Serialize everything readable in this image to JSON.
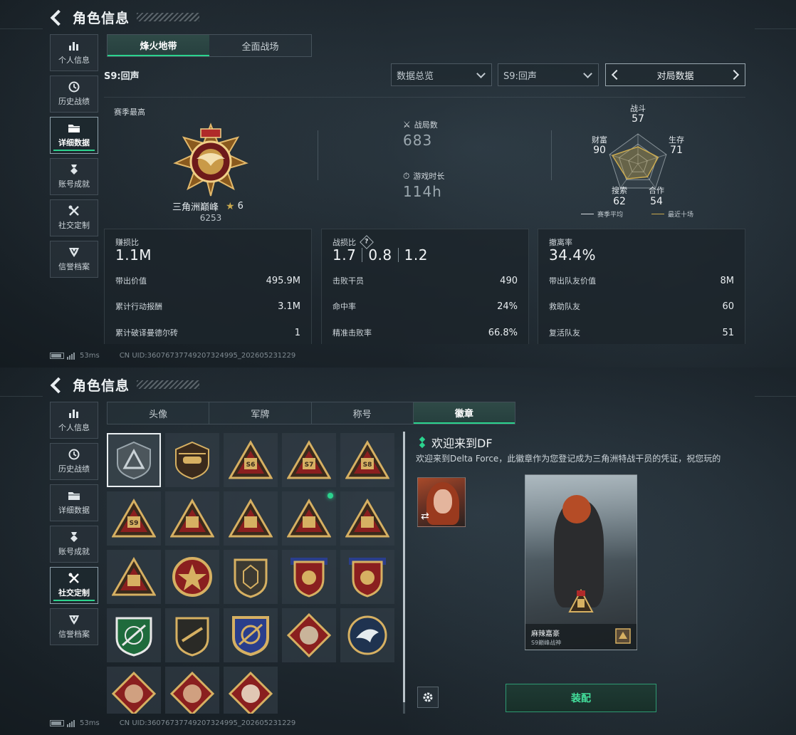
{
  "screen1": {
    "title": "角色信息",
    "sidebar": [
      {
        "label": "个人信息",
        "icon": "bar-chart-icon",
        "active": false
      },
      {
        "label": "历史战绩",
        "icon": "clock-icon",
        "active": false
      },
      {
        "label": "详细数据",
        "icon": "folder-icon",
        "active": true
      },
      {
        "label": "账号成就",
        "icon": "medal-icon",
        "active": false
      },
      {
        "label": "社交定制",
        "icon": "tools-icon",
        "active": false
      },
      {
        "label": "信誉档案",
        "icon": "shield-icon",
        "active": false
      }
    ],
    "tabs": [
      {
        "label": "烽火地带",
        "active": true
      },
      {
        "label": "全面战场",
        "active": false
      }
    ],
    "season_label": "S9:回声",
    "dropdown_overview": "数据总览",
    "dropdown_season": "S9:回声",
    "pager_label": "对局数据",
    "season_best_label": "赛季最高",
    "rank_name": "三角洲巅峰",
    "rank_stars": "6",
    "rank_score": "6253",
    "matches_label": "战局数",
    "matches_value": "683",
    "playtime_label": "游戏时长",
    "playtime_value": "114h",
    "radar": {
      "axes": [
        {
          "label": "战斗",
          "value": "57"
        },
        {
          "label": "生存",
          "value": "71"
        },
        {
          "label": "合作",
          "value": "54"
        },
        {
          "label": "搜索",
          "value": "62"
        },
        {
          "label": "财富",
          "value": "90"
        }
      ],
      "legend_avg": "赛季平均",
      "legend_recent": "最近十场",
      "colors": {
        "avg": "#d8dde0",
        "recent": "#c9a94e"
      }
    },
    "panels": {
      "profit": {
        "title": "赚损比",
        "value": "1.1M",
        "rows": [
          {
            "k": "带出价值",
            "v": "495.9M"
          },
          {
            "k": "累计行动报酬",
            "v": "3.1M"
          },
          {
            "k": "累计破译曼德尔砖",
            "v": "1"
          }
        ]
      },
      "kd": {
        "title": "战损比",
        "values": [
          "1.7",
          "0.8",
          "1.2"
        ],
        "rows": [
          {
            "k": "击败干员",
            "v": "490"
          },
          {
            "k": "命中率",
            "v": "24%"
          },
          {
            "k": "精准击败率",
            "v": "66.8%"
          }
        ]
      },
      "extract": {
        "title": "撤离率",
        "value": "34.4%",
        "rows": [
          {
            "k": "带出队友价值",
            "v": "8M"
          },
          {
            "k": "救助队友",
            "v": "60"
          },
          {
            "k": "复活队友",
            "v": "51"
          }
        ]
      }
    },
    "status": {
      "ping": "53ms",
      "uid": "CN UID:3607673774920732​4995_202605231229"
    }
  },
  "screen2": {
    "title": "角色信息",
    "sidebar": [
      {
        "label": "个人信息",
        "active": false
      },
      {
        "label": "历史战绩",
        "active": false
      },
      {
        "label": "详细数据",
        "active": false
      },
      {
        "label": "账号成就",
        "active": false
      },
      {
        "label": "社交定制",
        "active": true
      },
      {
        "label": "信誉档案",
        "active": false
      }
    ],
    "tabs": [
      {
        "label": "头像",
        "active": false
      },
      {
        "label": "军牌",
        "active": false
      },
      {
        "label": "称号",
        "active": false
      },
      {
        "label": "徽章",
        "active": true
      }
    ],
    "badge_labels": [
      "S6",
      "S7",
      "S8",
      "S9"
    ],
    "detail_title": "欢迎来到DF",
    "detail_desc": "欢迎来到Delta Force，此徽章作为您登记成为三角洲特战干员的凭证，祝您玩的",
    "card_name": "麻辣嘉豪",
    "card_sub": "S9巅峰战神",
    "equip_label": "装配",
    "status": {
      "ping": "53ms",
      "uid": "CN UID:36076737749207324995_202605231229"
    }
  }
}
